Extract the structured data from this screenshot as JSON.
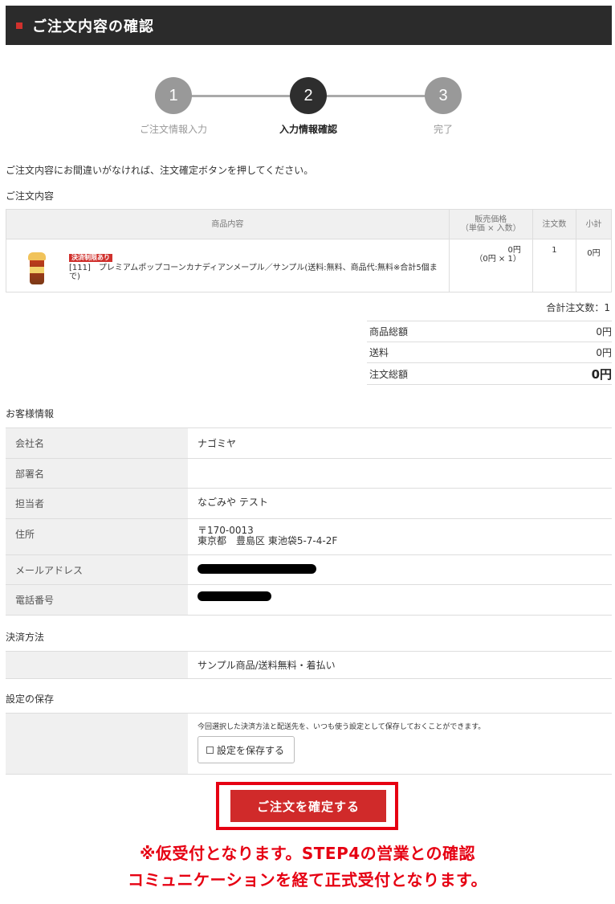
{
  "header": {
    "title": "ご注文内容の確認",
    "accent_color": "#d0312d"
  },
  "steps": [
    {
      "number": "1",
      "label": "ご注文情報入力",
      "state": "done"
    },
    {
      "number": "2",
      "label": "入力情報確認",
      "state": "current"
    },
    {
      "number": "3",
      "label": "完了",
      "state": "pending"
    }
  ],
  "intro_text": "ご注文内容にお間違いがなければ、注文確定ボタンを押してください。",
  "order": {
    "section_label": "ご注文内容",
    "columns": {
      "product": "商品内容",
      "price_line1": "販売価格",
      "price_line2": "（単価 × 入数）",
      "qty": "注文数",
      "subtotal": "小計"
    },
    "items": [
      {
        "badge": "決済制限あり",
        "name": "[111]　プレミアムポップコーンカナディアンメープル／サンプル(送料:無料、商品代:無料※合計5個まで)",
        "price": "0円",
        "price_detail": "（0円 × 1）",
        "qty": "1",
        "subtotal": "0円"
      }
    ],
    "total_count": "合計注文数：1",
    "totals": {
      "goods_label": "商品総額",
      "goods_value": "0円",
      "shipping_label": "送料",
      "shipping_value": "0円",
      "grand_label": "注文総額",
      "grand_value": "0円"
    }
  },
  "customer": {
    "section_label": "お客様情報",
    "company_label": "会社名",
    "company_value": "ナゴミヤ",
    "dept_label": "部署名",
    "dept_value": "",
    "person_label": "担当者",
    "person_value": "なごみや テスト",
    "address_label": "住所",
    "postal": "〒170-0013",
    "address": "東京都　豊島区 東池袋5-7-4-2F",
    "email_label": "メールアドレス",
    "phone_label": "電話番号"
  },
  "payment": {
    "section_label": "決済方法",
    "value": "サンプル商品/送料無料・着払い"
  },
  "save_settings": {
    "section_label": "設定の保存",
    "note": "今回選択した決済方法と配送先を、いつも使う設定として保存しておくことができます。",
    "button_label": "設定を保存する"
  },
  "confirm_button": "ご注文を確定する",
  "notice": {
    "line1": "※仮受付となります。STEP4の営業との確認",
    "line2": "コミュニケーションを経て正式受付となります。"
  }
}
